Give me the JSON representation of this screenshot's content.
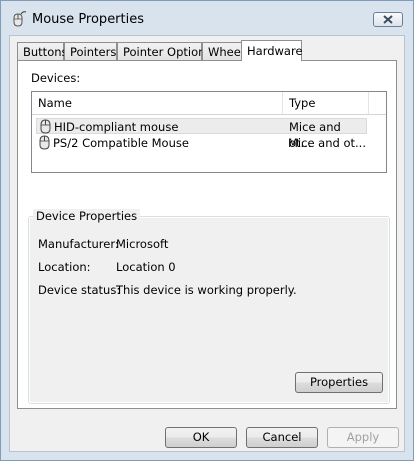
{
  "window": {
    "title": "Mouse Properties",
    "icon": "mouse-icon",
    "close_icon": "close-icon"
  },
  "tabs": [
    {
      "label": "Buttons",
      "active": false
    },
    {
      "label": "Pointers",
      "active": false
    },
    {
      "label": "Pointer Options",
      "active": false
    },
    {
      "label": "Wheel",
      "active": false
    },
    {
      "label": "Hardware",
      "active": true
    }
  ],
  "devices": {
    "label": "Devices:",
    "columns": [
      "Name",
      "Type"
    ],
    "rows": [
      {
        "name": "HID-compliant mouse",
        "type": "Mice and ot...",
        "selected": true,
        "icon": "mouse-icon"
      },
      {
        "name": "PS/2 Compatible Mouse",
        "type": "Mice and ot...",
        "selected": false,
        "icon": "mouse-icon"
      }
    ]
  },
  "device_properties": {
    "title": "Device Properties",
    "manufacturer_label": "Manufacturer:",
    "manufacturer_value": "Microsoft",
    "location_label": "Location:",
    "location_value": "Location 0",
    "status_label": "Device status:",
    "status_value": "This device is working properly.",
    "properties_button": "Properties"
  },
  "footer": {
    "ok": "OK",
    "cancel": "Cancel",
    "apply": "Apply",
    "apply_enabled": false
  }
}
